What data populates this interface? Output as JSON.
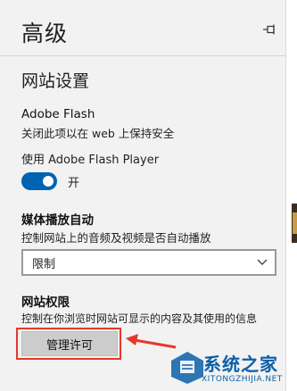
{
  "header": {
    "title": "高级"
  },
  "section": {
    "title": "网站设置"
  },
  "adobe_flash": {
    "heading": "Adobe Flash",
    "description": "关闭此项以在 web 上保持安全",
    "toggle_label": "使用 Adobe Flash Player",
    "toggle_state": "开",
    "toggle_on": true
  },
  "autoplay": {
    "heading": "媒体播放自动",
    "description": "控制网站上的音频及视频是否自动播放",
    "selected": "限制"
  },
  "permissions": {
    "heading": "网站权限",
    "description": "控制在你浏览时网站可显示的内容及其使用的信息",
    "button_label": "管理许可"
  },
  "watermark": {
    "name": "系统之家",
    "url": "XITONGZHIJIA.NET"
  },
  "colors": {
    "accent": "#0063b1",
    "highlight": "#e4392b"
  }
}
